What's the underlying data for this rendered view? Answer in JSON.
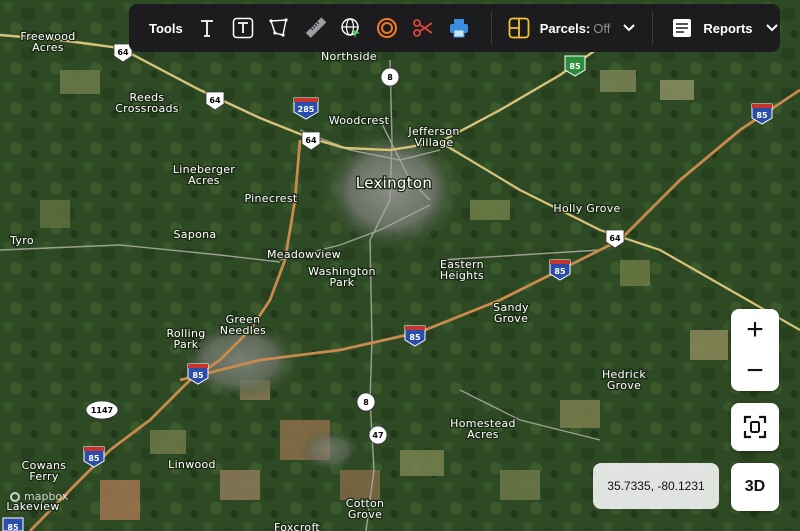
{
  "toolbar": {
    "tools_label": "Tools",
    "parcels_label": "Parcels:",
    "parcels_state": "Off",
    "reports_label": "Reports",
    "icons": [
      "text-icon",
      "text-box-icon",
      "polygon-icon",
      "ruler-icon",
      "globe-icon",
      "buffer-circle-icon",
      "scissors-icon",
      "print-icon",
      "parcels-icon",
      "reports-icon"
    ]
  },
  "map": {
    "city": "Lexington",
    "places": [
      "Freewood Acres",
      "Northside",
      "Reeds Crossroads",
      "Woodcrest",
      "Jefferson Village",
      "Lineberger Acres",
      "Pinecrest",
      "Holly Grove",
      "Tyro",
      "Sapona",
      "Meadowview",
      "Washington Park",
      "Eastern Heights",
      "Sandy Grove",
      "Rolling Park",
      "Green Needles",
      "Hedrick Grove",
      "Homestead Acres",
      "Linwood",
      "Cowans Ferry",
      "Lakeview",
      "Cotton Grove",
      "Foxcroft"
    ],
    "shields": {
      "us64": "64",
      "i285": "285",
      "i85": "85",
      "nc8": "8",
      "nc47": "47",
      "sr1147": "1147"
    }
  },
  "controls": {
    "zoom_in": "+",
    "zoom_out": "−",
    "three_d": "3D"
  },
  "coordinates": "35.7335, -80.1231",
  "attribution": "mapbox",
  "colors": {
    "toolbar_bg": "#1c1c1e",
    "interstate_route": "#c98a4e",
    "us_route": "#d8c27a",
    "scissors_red": "#e0443c",
    "print_blue": "#3b8de0",
    "parcels_yellow": "#f2c230",
    "buffer_orange": "#f07a2a"
  }
}
